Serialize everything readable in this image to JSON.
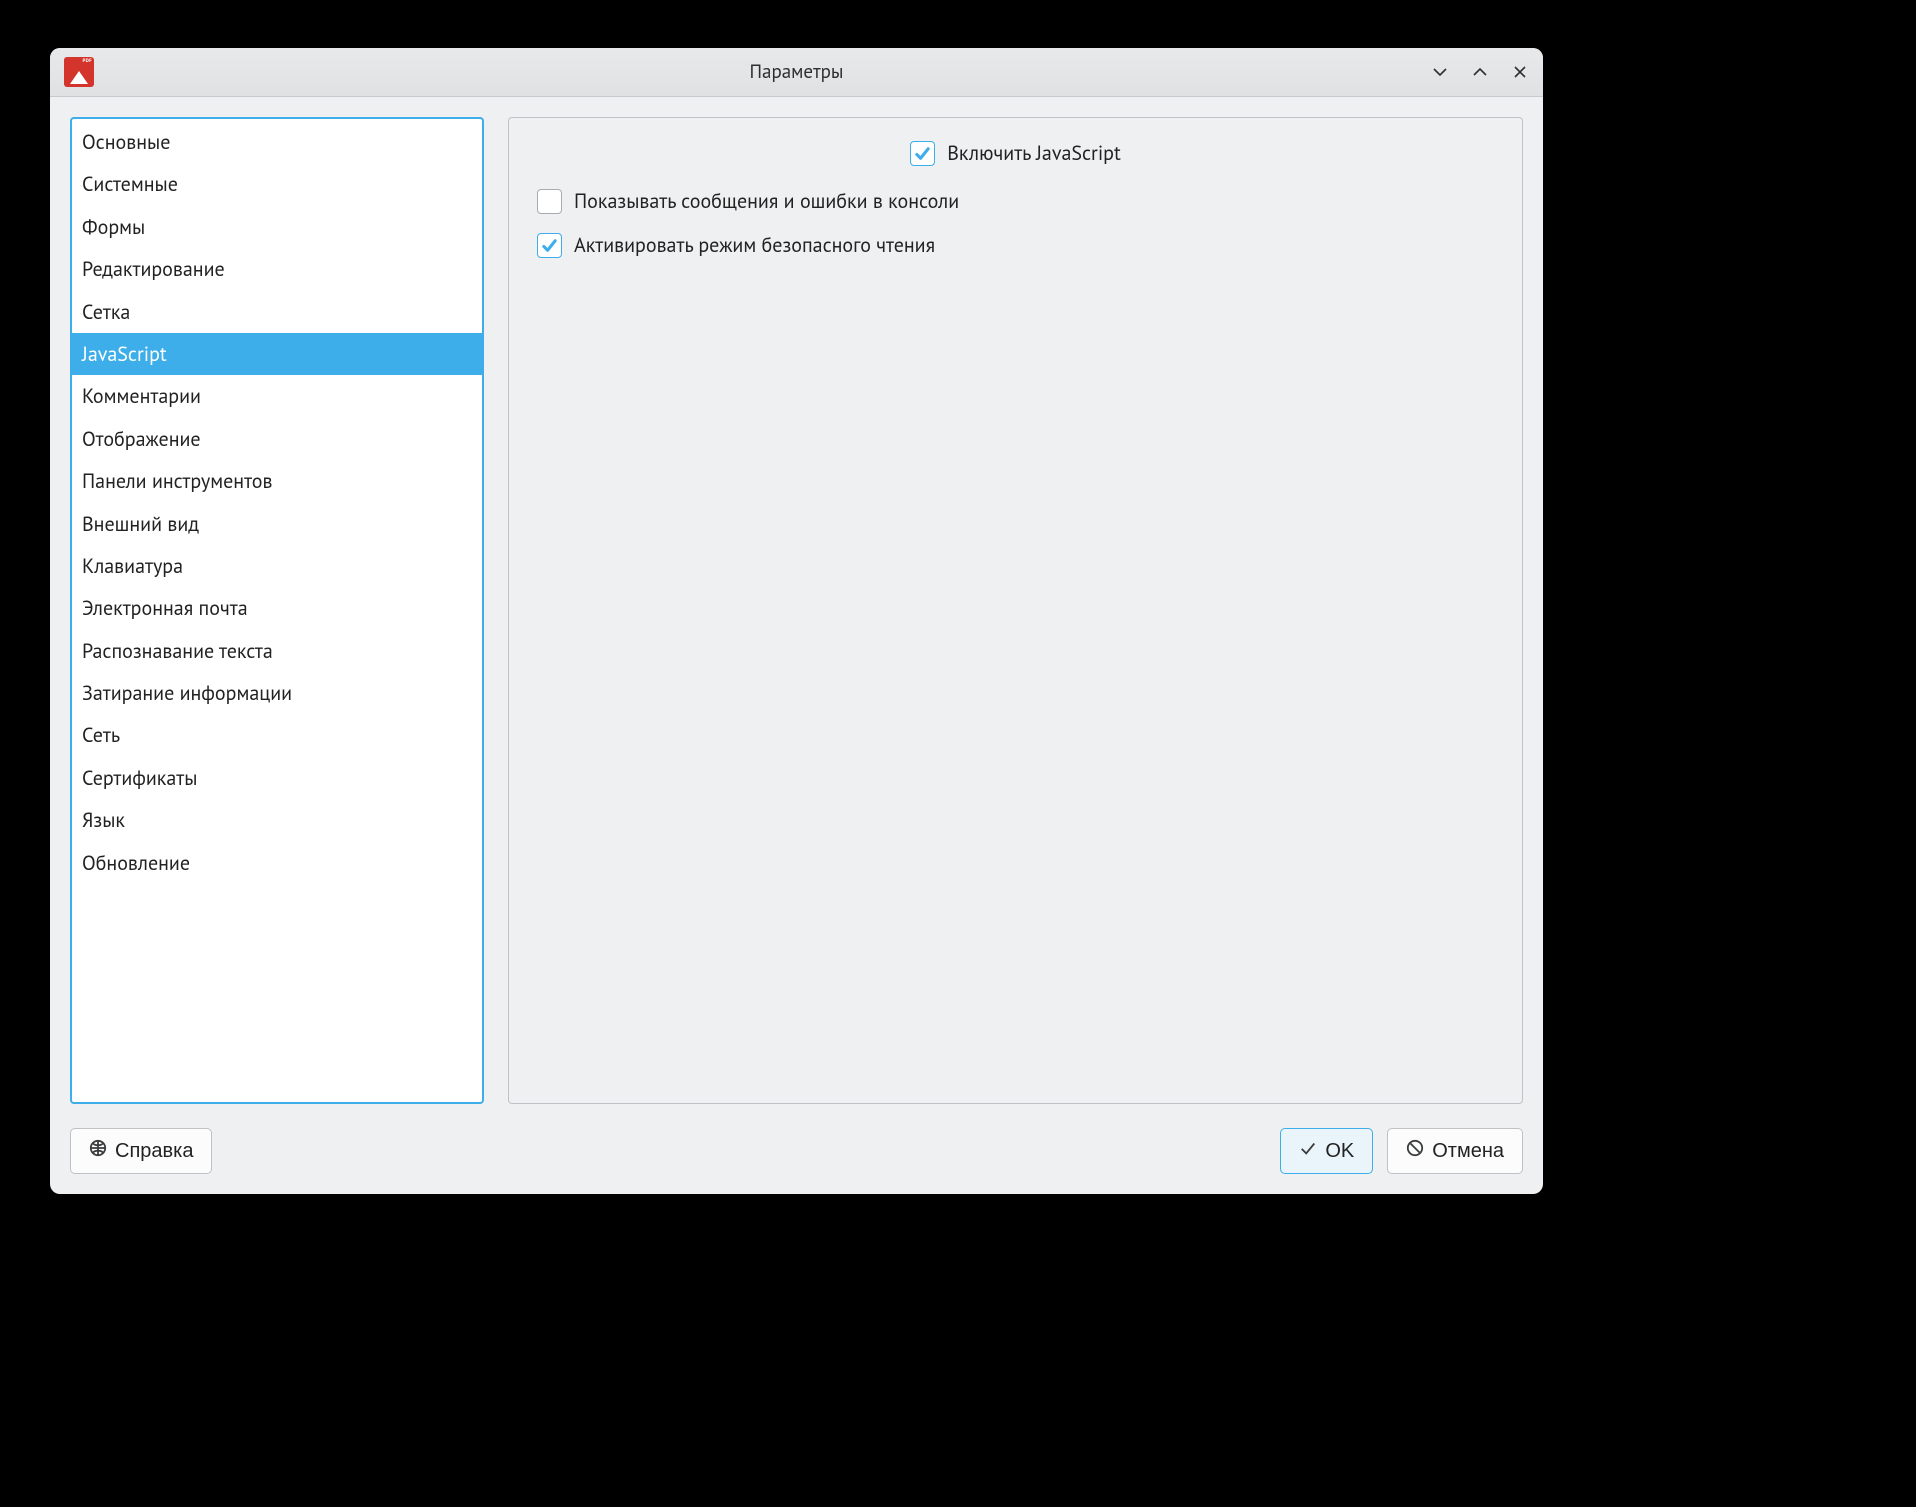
{
  "window": {
    "title": "Параметры"
  },
  "sidebar": {
    "items": [
      {
        "label": "Основные",
        "selected": false
      },
      {
        "label": "Системные",
        "selected": false
      },
      {
        "label": "Формы",
        "selected": false
      },
      {
        "label": "Редактирование",
        "selected": false
      },
      {
        "label": "Сетка",
        "selected": false
      },
      {
        "label": "JavaScript",
        "selected": true
      },
      {
        "label": "Комментарии",
        "selected": false
      },
      {
        "label": "Отображение",
        "selected": false
      },
      {
        "label": "Панели инструментов",
        "selected": false
      },
      {
        "label": "Внешний вид",
        "selected": false
      },
      {
        "label": "Клавиатура",
        "selected": false
      },
      {
        "label": "Электронная почта",
        "selected": false
      },
      {
        "label": "Распознавание текста",
        "selected": false
      },
      {
        "label": "Затирание информации",
        "selected": false
      },
      {
        "label": "Сеть",
        "selected": false
      },
      {
        "label": "Сертификаты",
        "selected": false
      },
      {
        "label": "Язык",
        "selected": false
      },
      {
        "label": "Обновление",
        "selected": false
      }
    ]
  },
  "content": {
    "options": [
      {
        "label": "Включить JavaScript",
        "checked": true,
        "align": "center"
      },
      {
        "label": "Показывать сообщения и ошибки в консоли",
        "checked": false,
        "align": "left"
      },
      {
        "label": "Активировать режим безопасного чтения",
        "checked": true,
        "align": "left"
      }
    ]
  },
  "buttons": {
    "help": "Справка",
    "ok": "OK",
    "cancel": "Отмена"
  }
}
